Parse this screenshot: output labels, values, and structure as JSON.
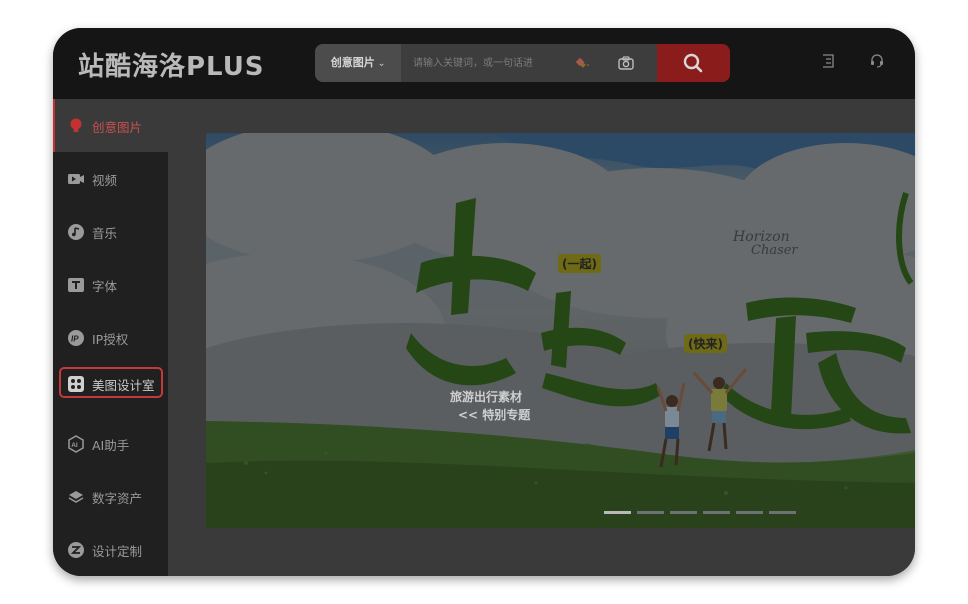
{
  "header": {
    "logo": "站酷海洛PLUS",
    "search": {
      "category": "创意图片",
      "placeholder": "请输入关键词，或一句话进"
    }
  },
  "sidebar": {
    "items": [
      {
        "label": "创意图片",
        "icon": "bulb-icon",
        "state": "active"
      },
      {
        "label": "视频",
        "icon": "video-icon"
      },
      {
        "label": "音乐",
        "icon": "music-icon"
      },
      {
        "label": "字体",
        "icon": "font-icon"
      },
      {
        "label": "IP授权",
        "icon": "ip-icon"
      },
      {
        "label": "美图设计室",
        "icon": "design-studio-icon",
        "state": "highlighted"
      },
      {
        "label": "AI助手",
        "icon": "ai-icon"
      },
      {
        "label": "数字资产",
        "icon": "layers-icon"
      },
      {
        "label": "设计定制",
        "icon": "custom-icon"
      }
    ]
  },
  "banner": {
    "headline": [
      "出",
      "去",
      "玩"
    ],
    "tag_together": "(一起)",
    "tag_hurry": "(快来)",
    "brand_line1": "Horizon",
    "brand_line2": "Chaser",
    "caption_line1": "旅游出行素材",
    "caption_line2": "<< 特别专题",
    "carousel": {
      "count": 6,
      "active": 1
    }
  },
  "colors": {
    "accent": "#c23232",
    "search_button": "#8b1c1c",
    "header_bg": "#151515",
    "sidebar_bg": "#202020"
  }
}
